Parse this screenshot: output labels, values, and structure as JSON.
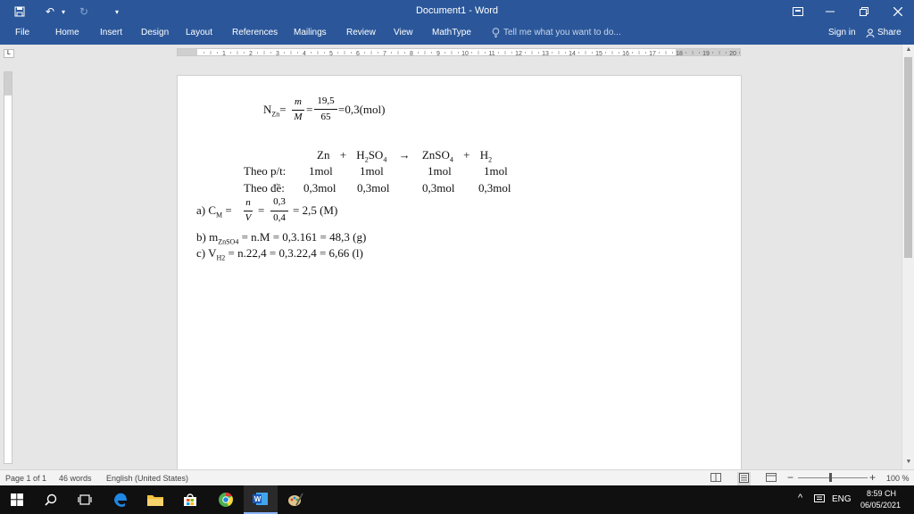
{
  "window": {
    "title": "Document1 - Word",
    "qat": {
      "undo": "↶",
      "undo_dd": "▾",
      "redo": "↻",
      "customize": "▾"
    }
  },
  "tabs": [
    "File",
    "Home",
    "Insert",
    "Design",
    "Layout",
    "References",
    "Mailings",
    "Review",
    "View",
    "MathType"
  ],
  "tellme": "Tell me what you want to do...",
  "account": {
    "signin": "Sign in",
    "share": "Share"
  },
  "ruler": {
    "numbers": [
      "1",
      "2",
      "3",
      "4",
      "5",
      "6",
      "7",
      "8",
      "9",
      "10",
      "11",
      "12",
      "13",
      "14",
      "15",
      "16",
      "17",
      "18",
      "19",
      "20"
    ]
  },
  "document": {
    "line1": {
      "lhs": "N",
      "lhs_sub": "Zn",
      "eq": "=",
      "num1": "m",
      "den1": "M",
      "eq2": "=",
      "num2": "19,5",
      "den2": "65",
      "rhs": "=0,3(mol)"
    },
    "reaction": {
      "zn": "Zn",
      "plus1": "+",
      "h2so4": "H",
      "h2so4_2": "2",
      "h2so4_so": "SO",
      "h2so4_4": "4",
      "arrow": "→",
      "znso4": "ZnSO",
      "znso4_4": "4",
      "plus2": "+",
      "h2": "H",
      "h2_2": "2"
    },
    "row_pt": {
      "label": "Theo p/t:",
      "v1": "1mol",
      "v2": "1mol",
      "v3": "1mol",
      "v4": "1mol"
    },
    "row_de": {
      "label": "Theo đề:",
      "v1": "0,3mol",
      "v2": "0,3mol",
      "v3": "0,3mol",
      "v4": "0,3mol"
    },
    "a": {
      "prefix": "a) C",
      "sub": "M",
      "eq": "=",
      "num1": "n",
      "den1": "V",
      "eq2": "=",
      "num2": "0,3",
      "den2": "0,4",
      "rhs": "= 2,5 (M)"
    },
    "b": {
      "prefix": "b) m",
      "sub": "ZnSO4",
      "rhs": "= n.M = 0,3.161 = 48,3 (g)"
    },
    "c": {
      "prefix": "c) V",
      "sub": "H2",
      "rhs": "= n.22,4 = 0,3.22,4 = 6,66 (l)"
    }
  },
  "status": {
    "page": "Page 1 of 1",
    "words": "46 words",
    "language": "English (United States)",
    "zoom": "100 %"
  },
  "taskbar": {
    "lang": "ENG",
    "time": "8:59 CH",
    "date": "06/05/2021"
  },
  "colors": {
    "ribbon": "#2b579a",
    "taskbar": "#101010"
  }
}
